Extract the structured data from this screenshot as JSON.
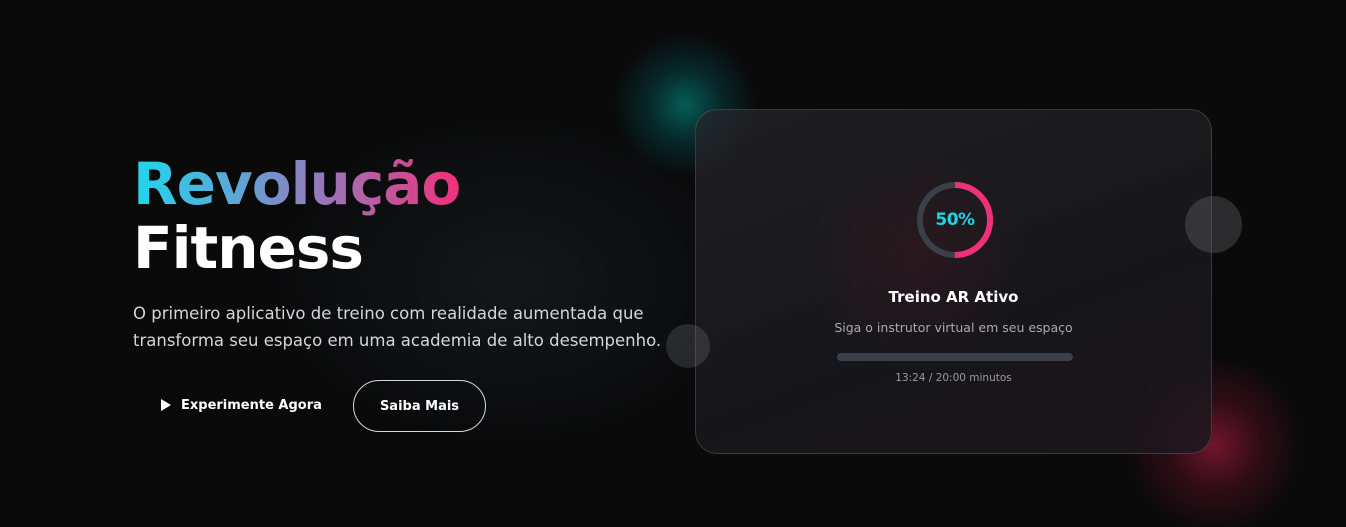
{
  "hero": {
    "title_line1": "Revolução",
    "title_line2": "Fitness",
    "subtitle": "O primeiro aplicativo de treino com realidade aumentada que transforma seu espaço em uma academia de alto desempenho."
  },
  "buttons": {
    "primary_label": "Experimente Agora",
    "secondary_label": "Saiba Mais"
  },
  "card": {
    "progress_label": "50%",
    "progress_fraction": 0.5,
    "title": "Treino AR Ativo",
    "description": "Siga o instrutor virtual em seu espaço",
    "time": "13:24 / 20:00 minutos"
  },
  "colors": {
    "background": "#0a0a0b",
    "accent_cyan": "#22d3e6",
    "accent_pink": "#f0317a",
    "ring_track": "#3b3f4a"
  },
  "icons": {
    "primary_button_icon": "play-icon"
  }
}
